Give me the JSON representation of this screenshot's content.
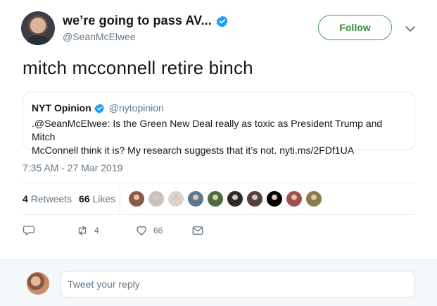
{
  "author": {
    "display_name": "we’re going to pass AV...",
    "handle": "@SeanMcElwee",
    "follow_label": "Follow"
  },
  "tweet": {
    "text": "mitch mcconnell retire binch",
    "timestamp": "7:35 AM - 27 Mar 2019"
  },
  "quoted_tweet": {
    "name": "NYT Opinion",
    "handle": "@nytopinion",
    "line1": ".@SeanMcElwee: Is the Green New Deal really as toxic as President Trump and Mitch",
    "line2": "McConnell think it is? My research suggests that it’s not. nyti.ms/2FDf1UA"
  },
  "stats": {
    "retweets_count": "4",
    "retweets_label": "Retweets",
    "likes_count": "66",
    "likes_label": "Likes"
  },
  "likers": [
    {
      "color": "#8a5b4b"
    },
    {
      "color": "#c9c2bd"
    },
    {
      "color": "#d8d4cf"
    },
    {
      "color": "#5a7a93"
    },
    {
      "color": "#4b6b3e"
    },
    {
      "color": "#2c2c2c"
    },
    {
      "color": "#54413a"
    },
    {
      "color": "#000000"
    },
    {
      "color": "#a05050"
    },
    {
      "color": "#8b7a4a"
    }
  ],
  "actions": {
    "reply_icon": "reply-icon",
    "retweet_icon": "retweet-icon",
    "retweet_count": "4",
    "like_icon": "heart-icon",
    "like_count": "66",
    "dm_icon": "mail-icon"
  },
  "reply": {
    "placeholder": "Tweet your reply"
  },
  "colors": {
    "verified": "#1da1f2",
    "follow_border": "#4ba04b",
    "muted_text": "#657786"
  }
}
